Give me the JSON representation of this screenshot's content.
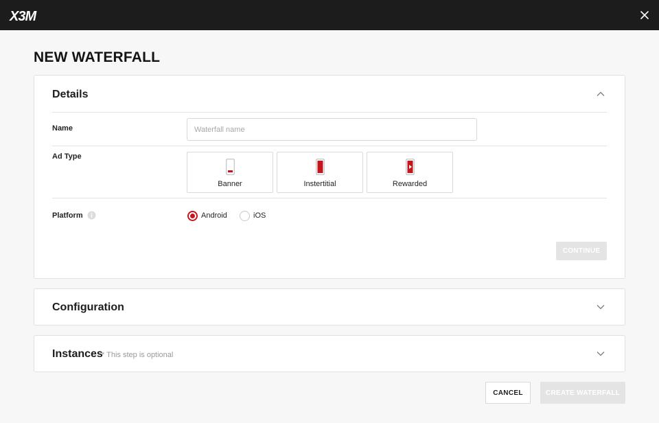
{
  "app": {
    "logo_name": "X3M"
  },
  "page": {
    "title": "NEW WATERFALL"
  },
  "details": {
    "title": "Details",
    "name": {
      "label": "Name",
      "placeholder": "Waterfall name",
      "value": ""
    },
    "ad_type": {
      "label": "Ad Type",
      "options": [
        {
          "label": "Banner",
          "icon": "banner-phone-icon"
        },
        {
          "label": "Instertitial",
          "icon": "interstitial-phone-icon"
        },
        {
          "label": "Rewarded",
          "icon": "rewarded-phone-icon"
        }
      ]
    },
    "platform": {
      "label": "Platform",
      "options": [
        {
          "label": "Android",
          "selected": true
        },
        {
          "label": "iOS",
          "selected": false
        }
      ]
    },
    "continue_label": "CONTINUE"
  },
  "configuration": {
    "title": "Configuration"
  },
  "instances": {
    "title": "Instances",
    "note": "* This step is optional"
  },
  "footer": {
    "cancel_label": "CANCEL",
    "create_label": "CREATE WATERFALL"
  },
  "colors": {
    "accent": "#c4161c",
    "topbar": "#1c1c1c",
    "disabled": "#e4e4e4"
  }
}
